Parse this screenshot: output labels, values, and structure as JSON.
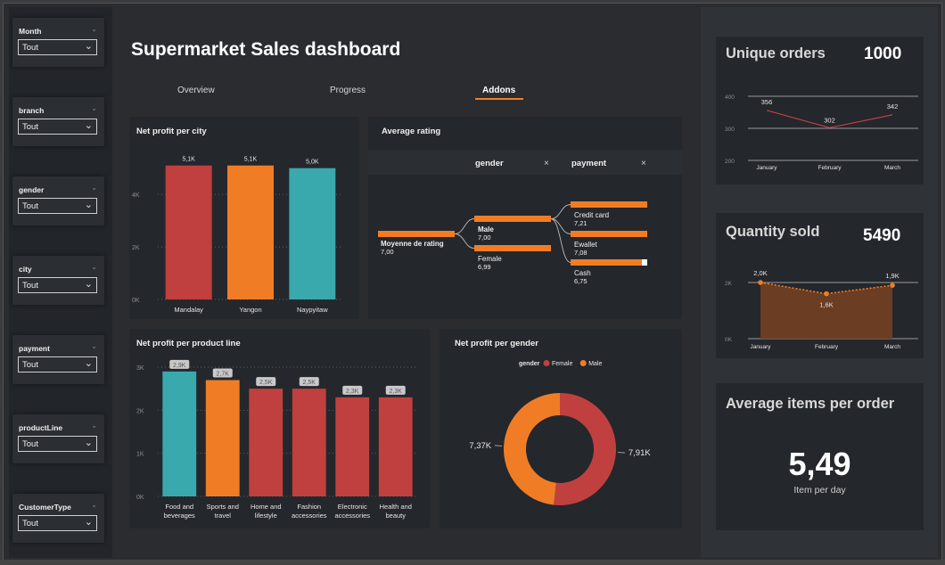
{
  "title": "Supermarket Sales dashboard",
  "tabs": [
    {
      "label": "Overview"
    },
    {
      "label": "Progress"
    },
    {
      "label": "Addons"
    }
  ],
  "filters": [
    {
      "label": "Month",
      "value": "Tout"
    },
    {
      "label": "branch",
      "value": "Tout"
    },
    {
      "label": "gender",
      "value": "Tout"
    },
    {
      "label": "city",
      "value": "Tout"
    },
    {
      "label": "payment",
      "value": "Tout"
    },
    {
      "label": "productLine",
      "value": "Tout"
    },
    {
      "label": "CustomerType",
      "value": "Tout"
    }
  ],
  "colors": {
    "red": "#c0403f",
    "orange": "#f07d26",
    "teal": "#3aa9ad",
    "brown": "#6b3d23"
  },
  "kpis": {
    "unique_orders": {
      "title": "Unique orders",
      "value": "1000"
    },
    "quantity_sold": {
      "title": "Quantity sold",
      "value": "5490"
    },
    "avg_items": {
      "title": "Average items per order",
      "value": "5,49",
      "subtitle": "Item per day"
    }
  },
  "decomp": {
    "title": "Average rating",
    "headers": [
      "gender",
      "payment"
    ],
    "close_glyph": "×",
    "root": {
      "label": "Moyenne de rating",
      "value": "7,00"
    },
    "level1": [
      {
        "label": "Male",
        "value": "7,00"
      },
      {
        "label": "Female",
        "value": "6,99"
      }
    ],
    "level2": [
      {
        "label": "Credit card",
        "value": "7,21"
      },
      {
        "label": "Ewallet",
        "value": "7,08"
      },
      {
        "label": "Cash",
        "value": "6,75"
      }
    ]
  },
  "chart_data": [
    {
      "type": "bar",
      "title": "Net profit per city",
      "categories": [
        "Mandalay",
        "Yangon",
        "Naypyitaw"
      ],
      "values": [
        5100,
        5100,
        5000
      ],
      "data_labels": [
        "5,1K",
        "5,1K",
        "5,0K"
      ],
      "bar_colors": [
        "#c0403f",
        "#f07d26",
        "#3aa9ad"
      ],
      "ylim": [
        0,
        5600
      ],
      "yticks": [
        0,
        2000,
        4000
      ],
      "ytick_labels": [
        "0K",
        "2K",
        "4K"
      ],
      "grid": true
    },
    {
      "type": "bar",
      "title": "Net profit per product line",
      "categories": [
        "Food and beverages",
        "Sports and travel",
        "Home and lifestyle",
        "Fashion accessories",
        "Electronic accessories",
        "Health and beauty"
      ],
      "category_lines": [
        [
          "Food and",
          "beverages"
        ],
        [
          "Sports and",
          "travel"
        ],
        [
          "Home and",
          "lifestyle"
        ],
        [
          "Fashion",
          "accessories"
        ],
        [
          "Electronic",
          "accessories"
        ],
        [
          "Health and",
          "beauty"
        ]
      ],
      "values": [
        2900,
        2700,
        2500,
        2500,
        2300,
        2300
      ],
      "data_labels": [
        "2,9K",
        "2,7K",
        "2,5K",
        "2,5K",
        "2,3K",
        "2,3K"
      ],
      "bar_colors": [
        "#3aa9ad",
        "#f07d26",
        "#c0403f",
        "#c0403f",
        "#c0403f",
        "#c0403f"
      ],
      "ylim": [
        0,
        3000
      ],
      "yticks": [
        0,
        1000,
        2000,
        3000
      ],
      "ytick_labels": [
        "0K",
        "1K",
        "2K",
        "3K"
      ],
      "grid": true
    },
    {
      "type": "pie",
      "title": "Net profit per gender",
      "legend_title": "gender",
      "legend": [
        "Female",
        "Male"
      ],
      "values": [
        7910,
        7370
      ],
      "data_labels": [
        "7,91K",
        "7,37K"
      ],
      "colors": [
        "#c0403f",
        "#f07d26"
      ]
    },
    {
      "type": "line",
      "categories": [
        "January",
        "February",
        "March"
      ],
      "values": [
        356,
        302,
        342
      ],
      "data_labels": [
        "356",
        "302",
        "342"
      ],
      "ylim": [
        200,
        400
      ],
      "yticks": [
        200,
        300,
        400
      ],
      "ytick_labels": [
        "200",
        "300",
        "400"
      ],
      "line_color": "#c0403f"
    },
    {
      "type": "area",
      "categories": [
        "January",
        "February",
        "March"
      ],
      "values": [
        2000,
        1600,
        1900
      ],
      "data_labels": [
        "2,0K",
        "1,6K",
        "1,9K"
      ],
      "ylim": [
        0,
        2000
      ],
      "yticks": [
        0,
        2000
      ],
      "ytick_labels": [
        "0K",
        "2K"
      ],
      "line_color": "#f07d26",
      "fill_color": "#6b3d23"
    }
  ]
}
